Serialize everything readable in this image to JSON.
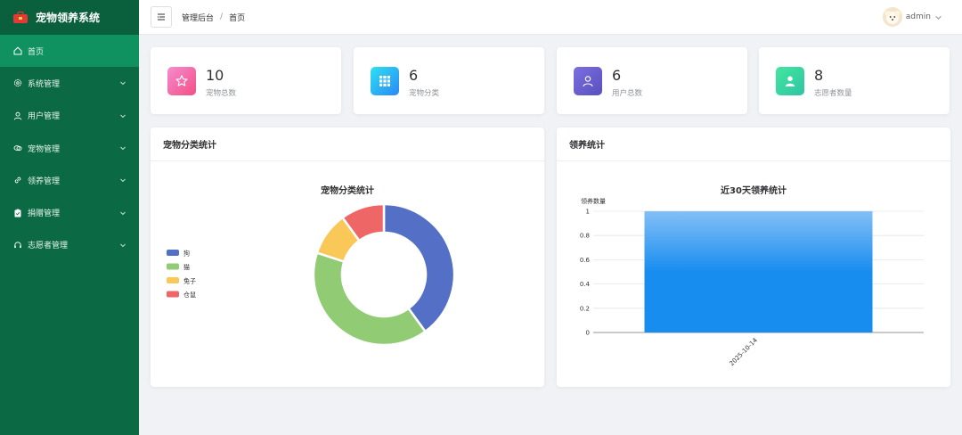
{
  "sidebar": {
    "title": "宠物领养系统",
    "items": [
      {
        "label": "首页",
        "icon": "home-icon",
        "active": true
      },
      {
        "label": "系统管理",
        "icon": "gear-icon"
      },
      {
        "label": "用户管理",
        "icon": "user-icon"
      },
      {
        "label": "宠物管理",
        "icon": "pet-icon"
      },
      {
        "label": "领养管理",
        "icon": "link-icon"
      },
      {
        "label": "捐赠管理",
        "icon": "clipboard-icon"
      },
      {
        "label": "志愿者管理",
        "icon": "headset-icon"
      }
    ]
  },
  "header": {
    "breadcrumb": [
      "管理后台",
      "首页"
    ],
    "breadcrumb_sep": "/",
    "user_name": "admin"
  },
  "stats": [
    {
      "value": "10",
      "label": "宠物总数",
      "icon": "star-icon",
      "color": "#f35c9b"
    },
    {
      "value": "6",
      "label": "宠物分类",
      "icon": "grid-icon",
      "color": "#2aa7f7"
    },
    {
      "value": "6",
      "label": "用户总数",
      "icon": "user-icon",
      "color": "#6a5fcf"
    },
    {
      "value": "8",
      "label": "志愿者数量",
      "icon": "person-icon",
      "color": "#38d39f"
    }
  ],
  "panels": {
    "category_title": "宠物分类统计",
    "adoption_title": "领养统计"
  },
  "chart_data": [
    {
      "type": "pie",
      "title": "宠物分类统计",
      "categories": [
        "狗",
        "猫",
        "兔子",
        "仓鼠"
      ],
      "values": [
        4,
        4,
        1,
        1
      ],
      "colors": [
        "#5470c6",
        "#91cc75",
        "#fac858",
        "#ee6666"
      ],
      "legend": "left"
    },
    {
      "type": "bar",
      "title": "近30天领养统计",
      "ylabel": "领养数量",
      "categories": [
        "2025-10-14"
      ],
      "values": [
        1
      ],
      "ylim": [
        0,
        1
      ],
      "yticks": [
        "0",
        "0.2",
        "0.4",
        "0.6",
        "0.8",
        "1"
      ],
      "grid": true
    }
  ]
}
